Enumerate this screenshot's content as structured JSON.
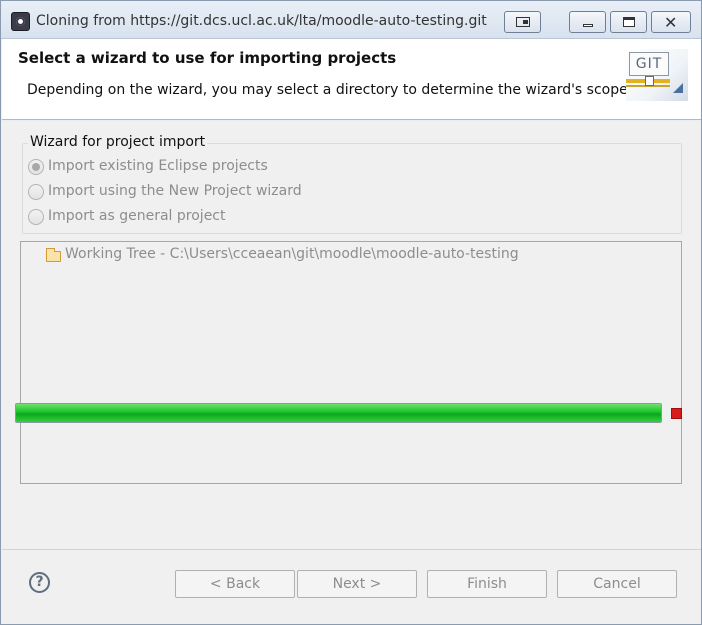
{
  "window": {
    "title": "Cloning from https://git.dcs.ucl.ac.uk/lta/moodle-auto-testing.git",
    "close_glyph": "✕"
  },
  "header": {
    "title": "Select a wizard to use for importing projects",
    "description": "Depending on the wizard, you may select a directory to determine the wizard's scope",
    "logo_text": "GIT"
  },
  "wizard_group": {
    "legend": "Wizard for project import",
    "options": [
      {
        "label": "Import existing Eclipse projects",
        "checked": true
      },
      {
        "label": "Import using the New Project wizard",
        "checked": false
      },
      {
        "label": "Import as general project",
        "checked": false
      }
    ]
  },
  "tree": {
    "items": [
      {
        "label": "Working Tree - C:\\Users\\cceaean\\git\\moodle\\moodle-auto-testing",
        "icon": "folder-open-icon"
      }
    ]
  },
  "progress": {
    "fraction": 1.0
  },
  "footer": {
    "help_glyph": "?",
    "back_label": "< Back",
    "next_label": "Next >",
    "finish_label": "Finish",
    "cancel_label": "Cancel"
  },
  "colors": {
    "progress_green": "#17c42c",
    "stop_red": "#d81b1b"
  }
}
